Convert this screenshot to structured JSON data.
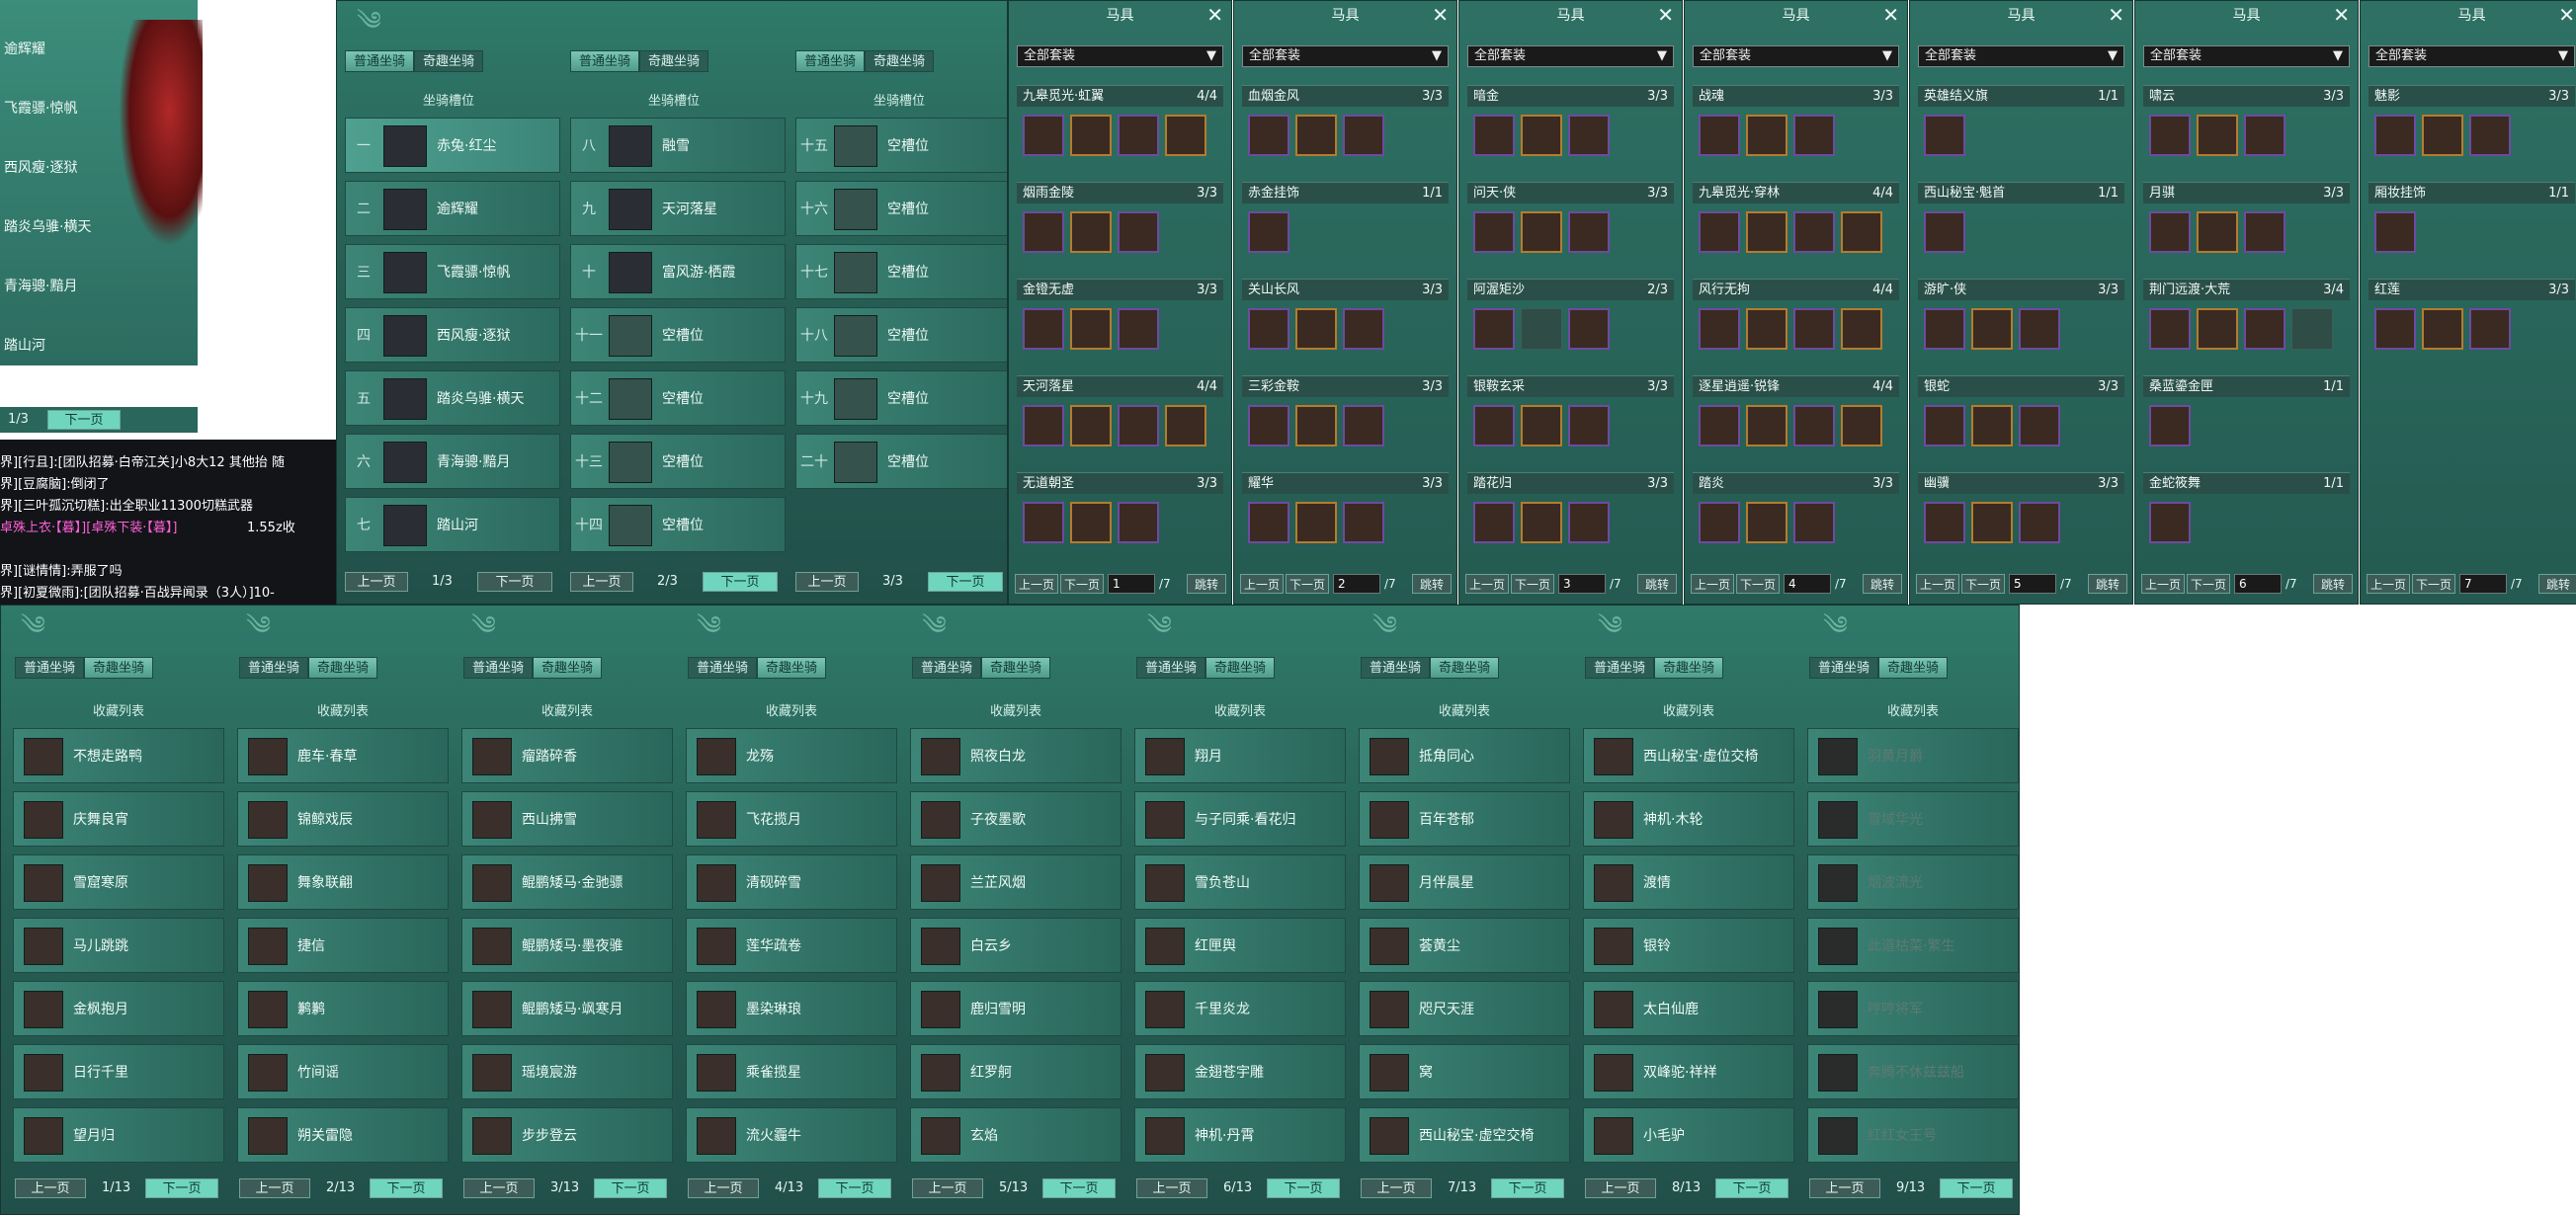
{
  "left": {
    "list": [
      "逾辉耀",
      "飞霞骠·惊帆",
      "西风瘦·逐狱",
      "踏炎乌骓·横天",
      "青海骢·黯月",
      "踏山河"
    ],
    "page": "1/3",
    "next": "下一页",
    "chat": [
      "界][行且]:[团队招募·白帝江关]小8大12 其他抬 随",
      "界][豆腐脑]:倒闭了",
      "界][三叶孤沉切糕]:出全职业11300切糕武器",
      "卓殊上衣·【暮】][卓殊下装·【暮】]",
      "1.55z收",
      "界][谜情情]:弄服了吗",
      "界][初夏微雨]:[团队招募·百战异闻录（3人）]10-"
    ]
  },
  "mounts": {
    "tab_normal": "普通坐骑",
    "tab_fun": "奇趣坐骑",
    "section": "坐骑槽位",
    "prev": "上一页",
    "next": "下一页",
    "cols": [
      {
        "page": "1/3",
        "slots": [
          {
            "n": "一",
            "name": "赤兔·红尘",
            "empty": false,
            "sel": true
          },
          {
            "n": "二",
            "name": "逾辉耀",
            "empty": false
          },
          {
            "n": "三",
            "name": "飞霞骠·惊帆",
            "empty": false
          },
          {
            "n": "四",
            "name": "西风瘦·逐狱",
            "empty": false
          },
          {
            "n": "五",
            "name": "踏炎乌骓·横天",
            "empty": false
          },
          {
            "n": "六",
            "name": "青海骢·黯月",
            "empty": false
          },
          {
            "n": "七",
            "name": "踏山河",
            "empty": false
          }
        ]
      },
      {
        "page": "2/3",
        "slots": [
          {
            "n": "八",
            "name": "融雪",
            "empty": false
          },
          {
            "n": "九",
            "name": "天河落星",
            "empty": false
          },
          {
            "n": "十",
            "name": "富风游·栖霞",
            "empty": false
          },
          {
            "n": "十一",
            "name": "空槽位",
            "empty": true
          },
          {
            "n": "十二",
            "name": "空槽位",
            "empty": true
          },
          {
            "n": "十三",
            "name": "空槽位",
            "empty": true
          },
          {
            "n": "十四",
            "name": "空槽位",
            "empty": true
          }
        ]
      },
      {
        "page": "3/3",
        "slots": [
          {
            "n": "十五",
            "name": "空槽位",
            "empty": true
          },
          {
            "n": "十六",
            "name": "空槽位",
            "empty": true
          },
          {
            "n": "十七",
            "name": "空槽位",
            "empty": true
          },
          {
            "n": "十八",
            "name": "空槽位",
            "empty": true
          },
          {
            "n": "十九",
            "name": "空槽位",
            "empty": true
          },
          {
            "n": "二十",
            "name": "空槽位",
            "empty": true
          },
          {
            "n": "",
            "name": "",
            "empty": true,
            "hidden": true
          }
        ]
      }
    ]
  },
  "harness": {
    "title": "马具",
    "close": "✕",
    "filter": "全部套装",
    "prev": "上一页",
    "next": "下一页",
    "jump": "跳转",
    "total": "/7",
    "panels": [
      {
        "page": "1",
        "sets": [
          {
            "name": "九皋觅光·虹翼",
            "count": "4/4",
            "items": 4
          },
          {
            "name": "烟雨金陵",
            "count": "3/3",
            "items": 3
          },
          {
            "name": "金镫无虚",
            "count": "3/3",
            "items": 3
          },
          {
            "name": "天河落星",
            "count": "4/4",
            "items": 4
          },
          {
            "name": "无道朝圣",
            "count": "3/3",
            "items": 3
          }
        ]
      },
      {
        "page": "2",
        "sets": [
          {
            "name": "血烟金风",
            "count": "3/3",
            "items": 3
          },
          {
            "name": "赤金挂饰",
            "count": "1/1",
            "items": 1
          },
          {
            "name": "关山长风",
            "count": "3/3",
            "items": 3
          },
          {
            "name": "三彩金鞍",
            "count": "3/3",
            "items": 3
          },
          {
            "name": "耀华",
            "count": "3/3",
            "items": 3
          }
        ]
      },
      {
        "page": "3",
        "sets": [
          {
            "name": "暗金",
            "count": "3/3",
            "items": 3
          },
          {
            "name": "问天·侠",
            "count": "3/3",
            "items": 3
          },
          {
            "name": "阿渥矩沙",
            "count": "2/3",
            "items": 3,
            "gap": 1
          },
          {
            "name": "银鞍玄采",
            "count": "3/3",
            "items": 3
          },
          {
            "name": "踏花归",
            "count": "3/3",
            "items": 3
          }
        ]
      },
      {
        "page": "4",
        "sets": [
          {
            "name": "战魂",
            "count": "3/3",
            "items": 3
          },
          {
            "name": "九皋觅光·穿林",
            "count": "4/4",
            "items": 4
          },
          {
            "name": "风行无拘",
            "count": "4/4",
            "items": 4
          },
          {
            "name": "逐星逍遥·锐锋",
            "count": "4/4",
            "items": 4
          },
          {
            "name": "踏炎",
            "count": "3/3",
            "items": 3
          }
        ]
      },
      {
        "page": "5",
        "sets": [
          {
            "name": "英雄结义旗",
            "count": "1/1",
            "items": 1
          },
          {
            "name": "西山秘宝·魁首",
            "count": "1/1",
            "items": 1
          },
          {
            "name": "游旷·侠",
            "count": "3/3",
            "items": 3
          },
          {
            "name": "银蛇",
            "count": "3/3",
            "items": 3
          },
          {
            "name": "幽骥",
            "count": "3/3",
            "items": 3
          }
        ]
      },
      {
        "page": "6",
        "sets": [
          {
            "name": "啸云",
            "count": "3/3",
            "items": 3
          },
          {
            "name": "月骐",
            "count": "3/3",
            "items": 3
          },
          {
            "name": "荆门远渡·大荒",
            "count": "3/4",
            "items": 4,
            "gap": 3
          },
          {
            "name": "桑蓝鎏金匣",
            "count": "1/1",
            "items": 1
          },
          {
            "name": "金蛇筱舞",
            "count": "1/1",
            "items": 1
          }
        ]
      },
      {
        "page": "7",
        "sets": [
          {
            "name": "魅影",
            "count": "3/3",
            "items": 3
          },
          {
            "name": "厢妆挂饰",
            "count": "1/1",
            "items": 1
          },
          {
            "name": "红莲",
            "count": "3/3",
            "items": 3
          }
        ]
      }
    ]
  },
  "collection": {
    "tab_normal": "普通坐骑",
    "tab_fun": "奇趣坐骑",
    "section": "收藏列表",
    "prev": "上一页",
    "next": "下一页",
    "cols": [
      {
        "page": "1/13",
        "items": [
          "不想走路鸭",
          "庆舞良宵",
          "雪窟寒原",
          "马儿跳跳",
          "金枫抱月",
          "日行千里",
          "望月归"
        ]
      },
      {
        "page": "2/13",
        "items": [
          "鹿车·春草",
          "锦鲸戏辰",
          "舞象联翩",
          "捷信",
          "鹣鹣",
          "竹间谣",
          "朔关雷隐"
        ]
      },
      {
        "page": "3/13",
        "items": [
          "瘤踏碎香",
          "西山拂雪",
          "鲲鹏矮马·金驰骠",
          "鲲鹏矮马·墨夜骓",
          "鲲鹏矮马·飒寒月",
          "瑶境宸游",
          "步步登云"
        ]
      },
      {
        "page": "4/13",
        "items": [
          "龙殇",
          "飞花揽月",
          "清砚碎雪",
          "莲华疏卷",
          "墨染琳琅",
          "乘雀揽星",
          "流火霾牛"
        ]
      },
      {
        "page": "5/13",
        "items": [
          "照夜白龙",
          "子夜墨歌",
          "兰芷风烟",
          "白云乡",
          "鹿归雪明",
          "红罗舸",
          "玄焰"
        ]
      },
      {
        "page": "6/13",
        "items": [
          "翔月",
          "与子同乘·看花归",
          "雪负苍山",
          "红匣舆",
          "千里炎龙",
          "金翅苍宇雕",
          "神机·丹霄"
        ]
      },
      {
        "page": "7/13",
        "items": [
          "抵角同心",
          "百年苍郁",
          "月伴晨星",
          "荟黄尘",
          "咫尺天涯",
          "窝",
          "西山秘宝·虚空交椅"
        ]
      },
      {
        "page": "8/13",
        "items": [
          "西山秘宝·虚位交椅",
          "神机·木轮",
          "渡情",
          "银铃",
          "太白仙鹿",
          "双峰驼·祥祥",
          "小毛驴"
        ]
      },
      {
        "page": "9/13",
        "items": [
          "羽黄月爵",
          "雪域华光",
          "烟波流光",
          "此道枯菜·繁生",
          "哼哼将军",
          "奔腾不休兹兹船",
          "红红女王号"
        ],
        "dim": true
      }
    ]
  }
}
